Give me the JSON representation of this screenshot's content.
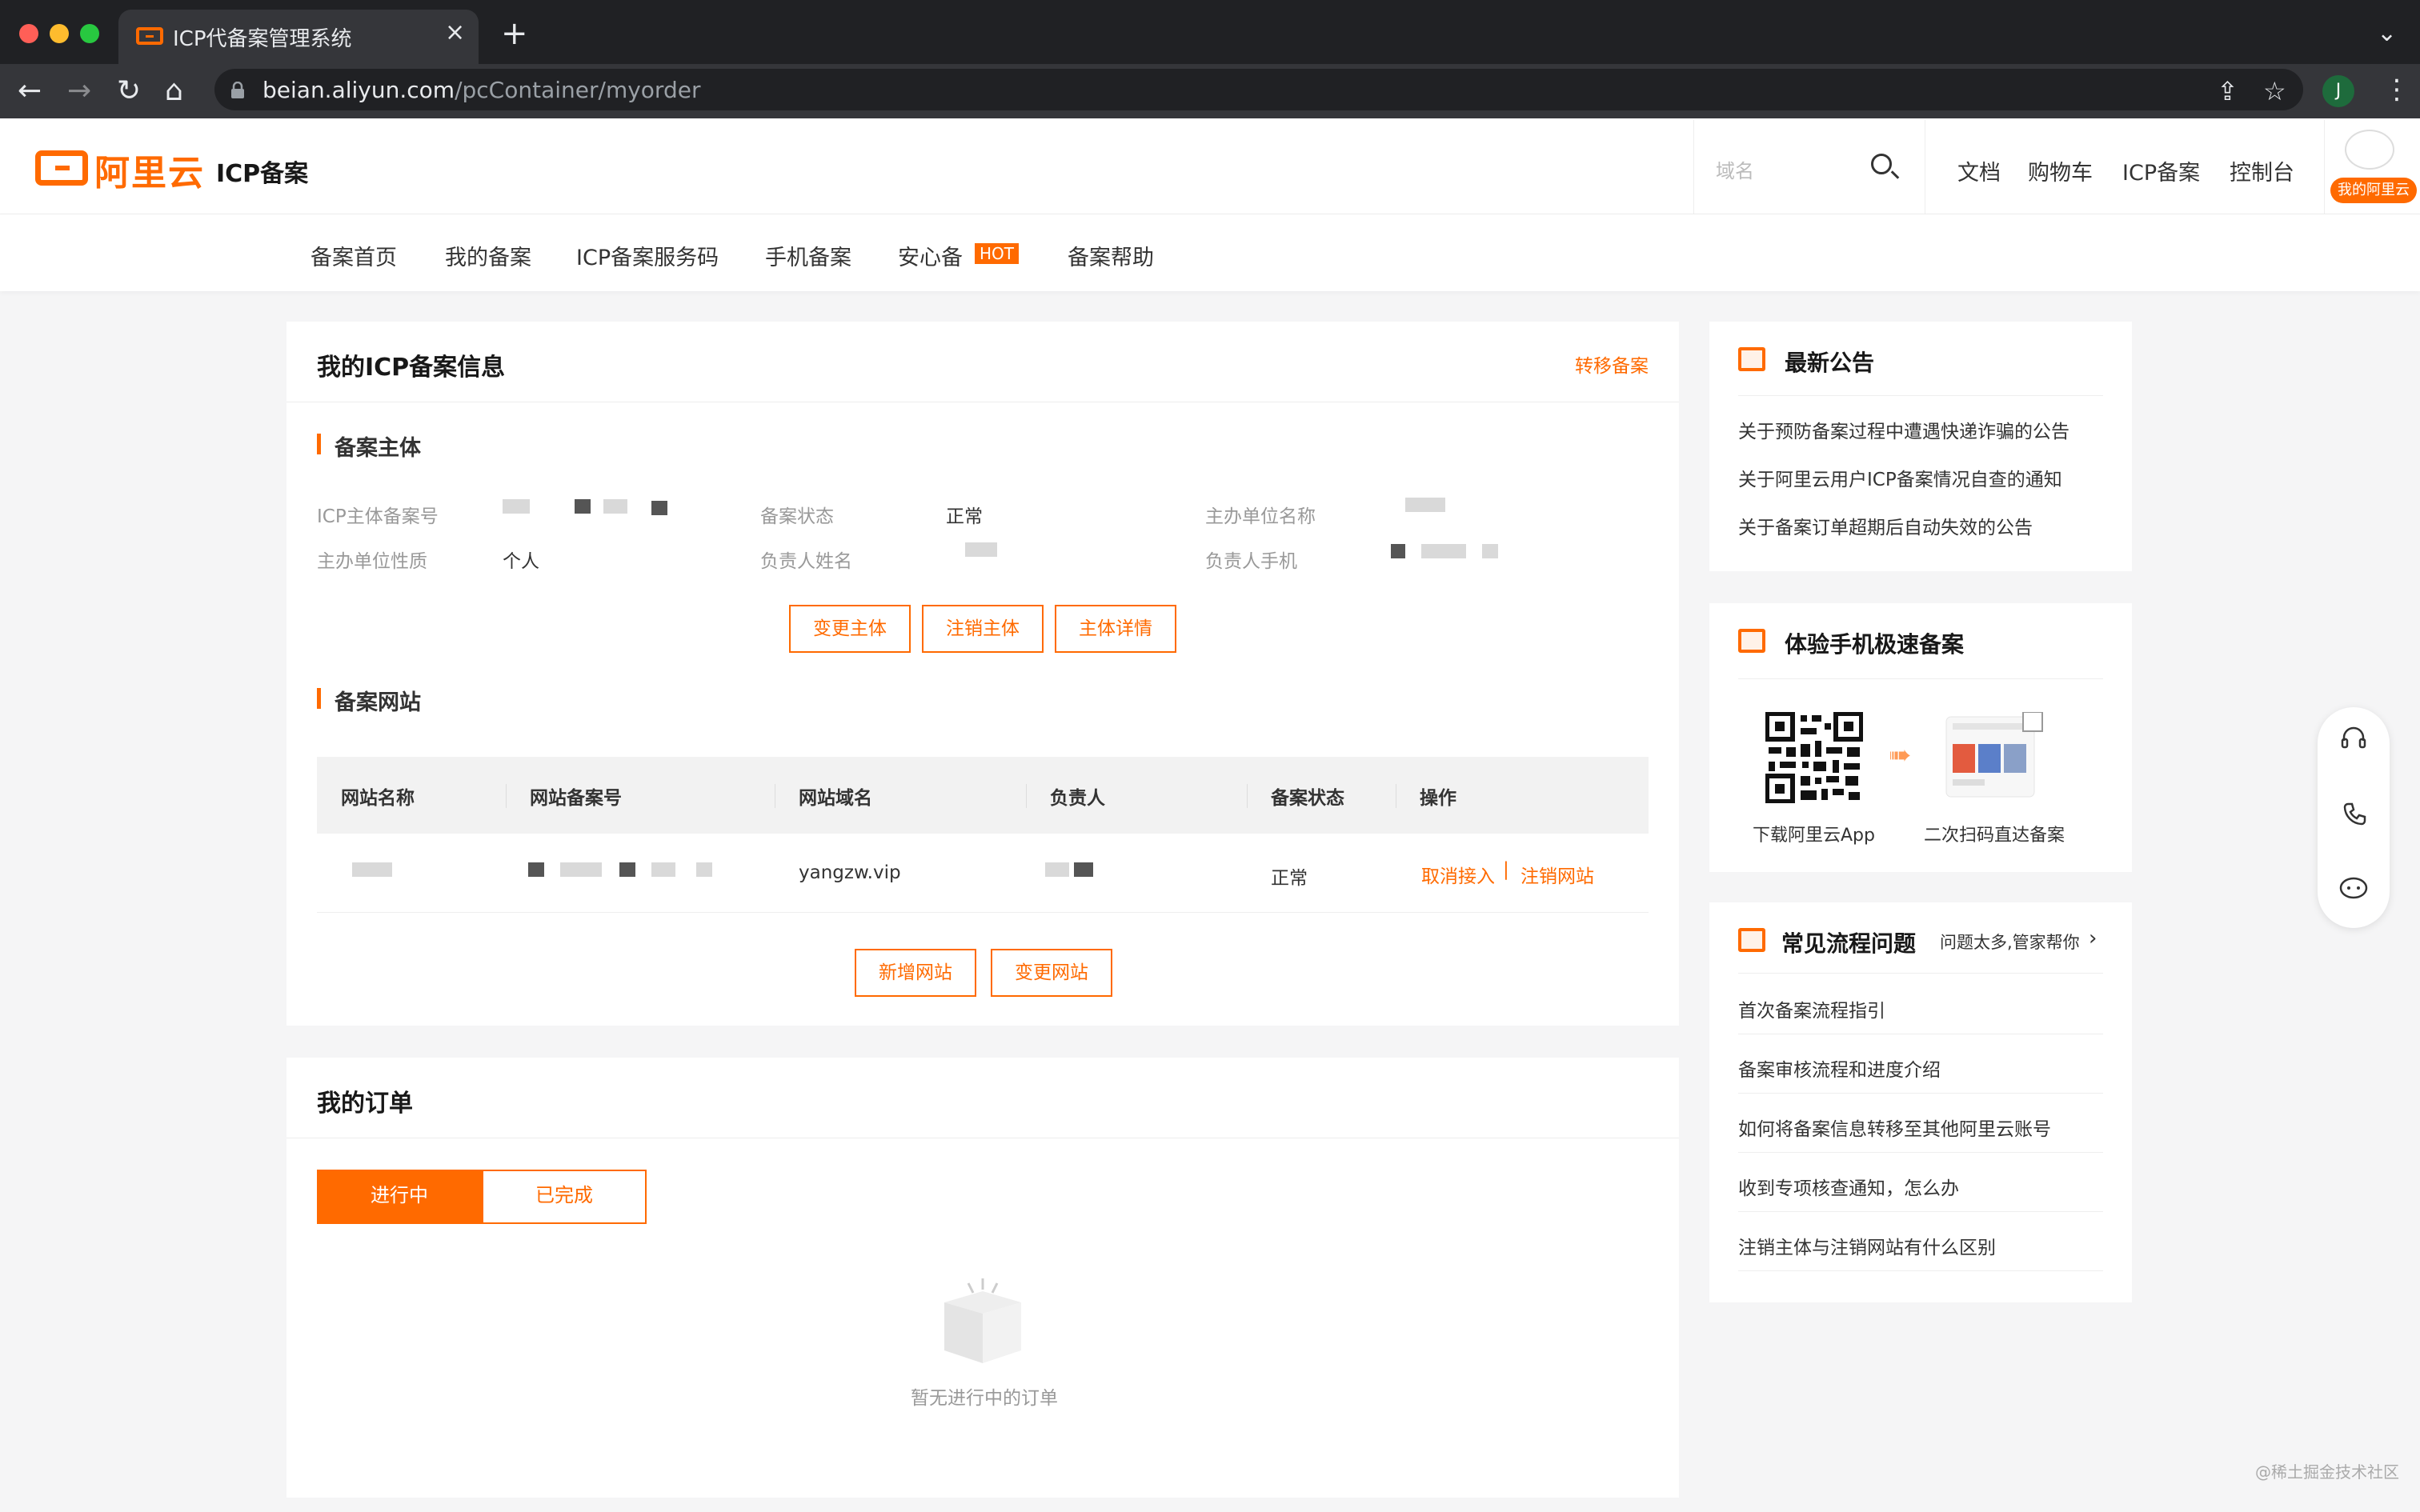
{
  "browser": {
    "tab_title": "ICP代备案管理系统",
    "url_host": "beian.aliyun.com",
    "url_path": "/pcContainer/myorder",
    "profile_initial": "J",
    "colors": {
      "chrome_dark": "#202124",
      "chrome_mid": "#35363a"
    }
  },
  "header": {
    "logo_text": "阿里云",
    "product_name": "ICP备案",
    "search_placeholder": "域名",
    "links": [
      "文档",
      "购物车",
      "ICP备案",
      "控制台"
    ],
    "avatar_badge": "我的阿里云",
    "accent_color": "#ff6a00"
  },
  "subnav": {
    "items": [
      "备案首页",
      "我的备案",
      "ICP备案服务码",
      "手机备案",
      "安心备",
      "备案帮助"
    ],
    "hot_badge": "HOT"
  },
  "icp_info": {
    "title": "我的ICP备案信息",
    "transfer_link": "转移备案",
    "subject": {
      "section_title": "备案主体",
      "fields": {
        "record_no_label": "ICP主体备案号",
        "status_label": "备案状态",
        "status_value": "正常",
        "org_name_label": "主办单位名称",
        "org_type_label": "主办单位性质",
        "org_type_value": "个人",
        "owner_name_label": "负责人姓名",
        "owner_phone_label": "负责人手机"
      },
      "buttons": [
        "变更主体",
        "注销主体",
        "主体详情"
      ]
    },
    "websites": {
      "section_title": "备案网站",
      "columns": [
        "网站名称",
        "网站备案号",
        "网站域名",
        "负责人",
        "备案状态",
        "操作"
      ],
      "rows": [
        {
          "domain": "yangzw.vip",
          "status": "正常",
          "action_cancel": "取消接入",
          "action_separator": "|",
          "action_deregister": "注销网站"
        }
      ],
      "buttons": [
        "新增网站",
        "变更网站"
      ]
    }
  },
  "orders": {
    "title": "我的订单",
    "tabs": [
      "进行中",
      "已完成"
    ],
    "empty_text": "暂无进行中的订单"
  },
  "announcements": {
    "title": "最新公告",
    "items": [
      "关于预防备案过程中遭遇快递诈骗的公告",
      "关于阿里云用户ICP备案情况自查的通知",
      "关于备案订单超期后自动失效的公告"
    ]
  },
  "mobile": {
    "title": "体验手机极速备案",
    "caption_download": "下载阿里云App",
    "caption_scan": "二次扫码直达备案"
  },
  "faq": {
    "title": "常见流程问题",
    "helper_link": "问题太多,管家帮你",
    "items": [
      "首次备案流程指引",
      "备案审核流程和进度介绍",
      "如何将备案信息转移至其他阿里云账号",
      "收到专项核查通知，怎么办",
      "注销主体与注销网站有什么区别"
    ]
  },
  "watermark": "@稀土掘金技术社区"
}
